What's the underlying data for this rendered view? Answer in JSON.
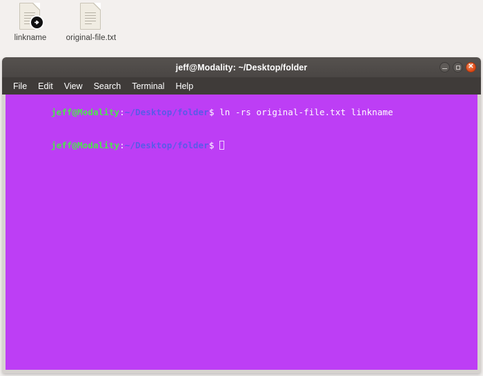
{
  "desktop": {
    "background_color": "#f3f0ee",
    "icons": [
      {
        "label": "linkname",
        "icon": "document-symlink-icon",
        "emblem": "symlink-arrow-icon"
      },
      {
        "label": "original-file.txt",
        "icon": "document-text-icon",
        "emblem": ""
      }
    ]
  },
  "terminal": {
    "title": "jeff@Modality: ~/Desktop/folder",
    "background_color": "#bd3ef5",
    "titlebar_color": "#4a4644",
    "window_buttons": [
      {
        "name": "minimize",
        "glyph": "–"
      },
      {
        "name": "maximize",
        "glyph": "□"
      },
      {
        "name": "close",
        "glyph": "✕"
      }
    ],
    "menu": [
      {
        "label": "File"
      },
      {
        "label": "Edit"
      },
      {
        "label": "View"
      },
      {
        "label": "Search"
      },
      {
        "label": "Terminal"
      },
      {
        "label": "Help"
      }
    ],
    "prompt": {
      "user_host": "jeff@Modality",
      "separator": ":",
      "path": "~/Desktop/folder",
      "symbol": "$",
      "user_color": "#4ee44e",
      "path_color": "#5a5ae8",
      "text_color": "#ffffff"
    },
    "lines": [
      {
        "type": "prompt",
        "command": "ln -rs original-file.txt linkname"
      },
      {
        "type": "prompt",
        "command": "",
        "cursor": true
      }
    ]
  }
}
